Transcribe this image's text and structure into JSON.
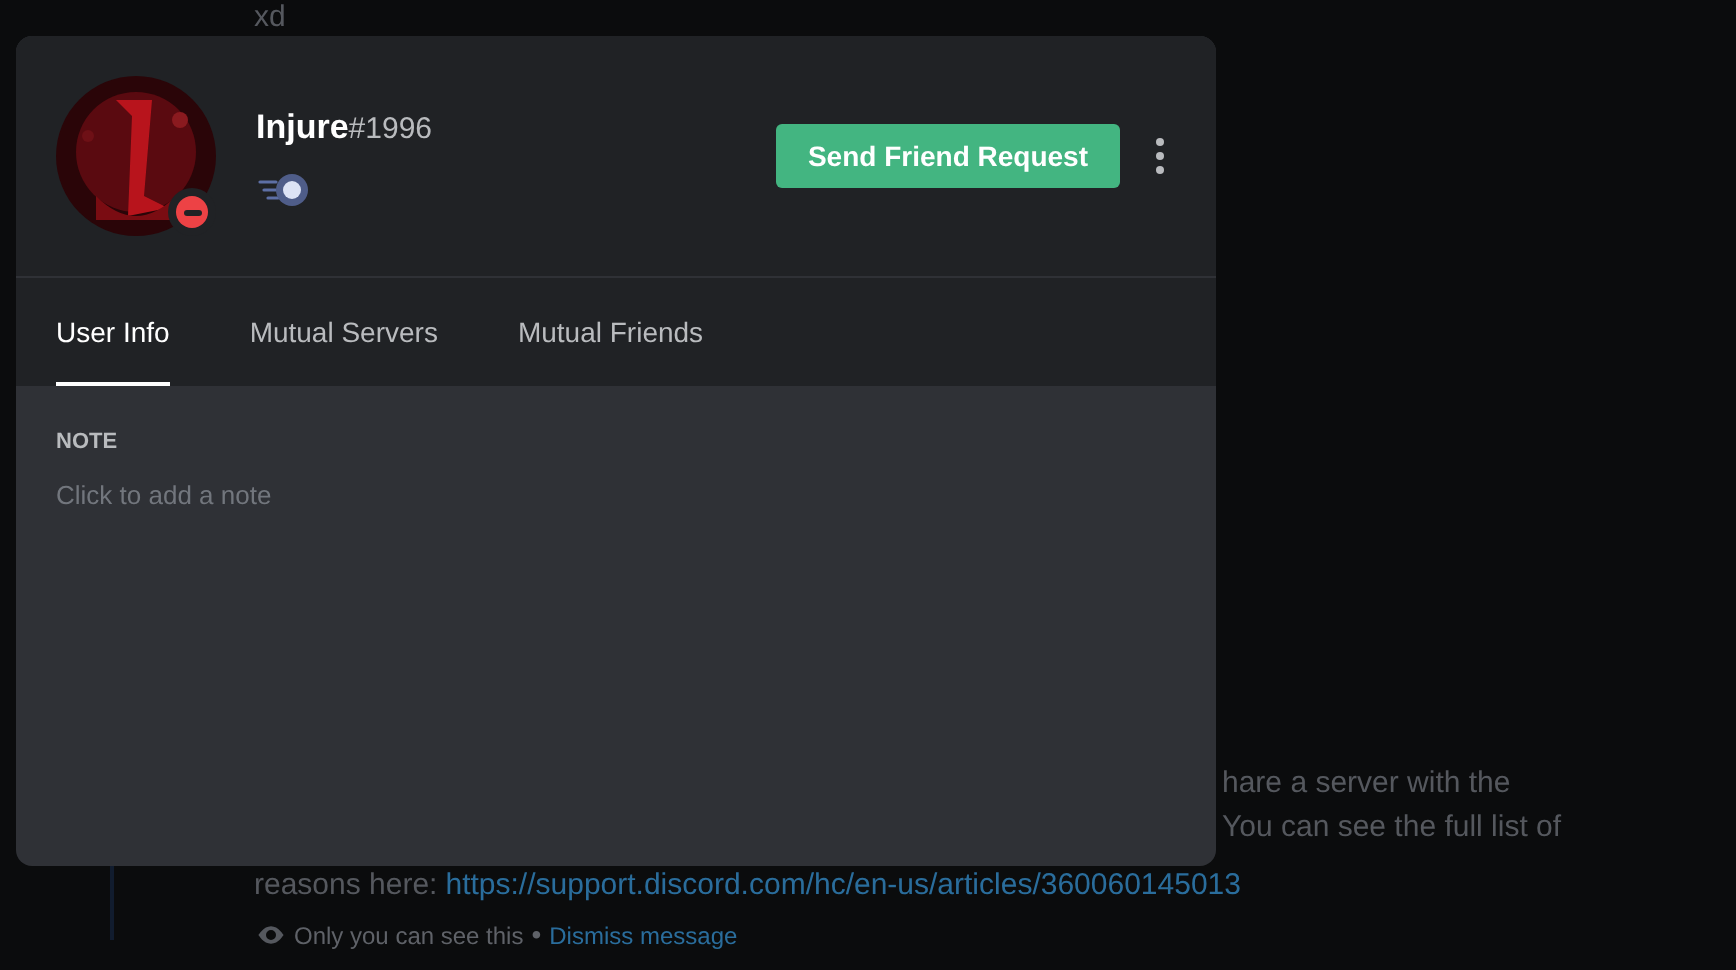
{
  "background": {
    "top_message": "xd",
    "message_lines": [
      "hare a server with the",
      "You can see the full list of"
    ],
    "reasons_text": "reasons here:",
    "reasons_link": "https://support.discord.com/hc/en-us/articles/360060145013",
    "footer_note": "Only you can see this",
    "footer_separator": "•",
    "footer_link": "Dismiss message"
  },
  "profile": {
    "username": "Injure",
    "discriminator": "#1996",
    "do_not_disturb": true,
    "primary_button": "Send Friend Request"
  },
  "tabs": [
    {
      "label": "User Info",
      "selected": true
    },
    {
      "label": "Mutual Servers",
      "selected": false
    },
    {
      "label": "Mutual Friends",
      "selected": false
    }
  ],
  "note": {
    "heading": "NOTE",
    "placeholder": "Click to add a note"
  }
}
